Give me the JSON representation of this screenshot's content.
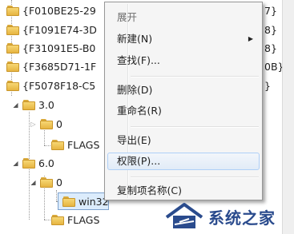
{
  "tree": {
    "keys": [
      {
        "label": "{F010BE25-29"
      },
      {
        "label": "{F1091E74-3D"
      },
      {
        "label": "{F31091E5-B0"
      },
      {
        "label": "{F3685D71-1F"
      },
      {
        "label": "{F5078F18-C5"
      }
    ],
    "right_fragments": [
      "7}",
      "8}",
      "8}",
      "0B}",
      "}"
    ],
    "sub": {
      "v30": "3.0",
      "v30_child0": "0",
      "v30_flags": "FLAGS",
      "v60": "6.0",
      "v60_child0": "0",
      "win32": "win32",
      "v60_flags": "FLAGS"
    }
  },
  "context_menu": {
    "items": [
      {
        "label": "展开",
        "disabled": true
      },
      {
        "label": "新建(N)",
        "submenu": true
      },
      {
        "label": "查找(F)..."
      },
      {
        "label": "删除(D)"
      },
      {
        "label": "重命名(R)"
      },
      {
        "label": "导出(E)"
      },
      {
        "label": "权限(P)...",
        "hovered": true
      },
      {
        "label": "复制项名称(C)"
      }
    ],
    "submenu_arrow": "▶"
  },
  "watermark": {
    "text": "系统之家"
  },
  "icons": {
    "expanded": "◢",
    "collapsed": "▷"
  }
}
